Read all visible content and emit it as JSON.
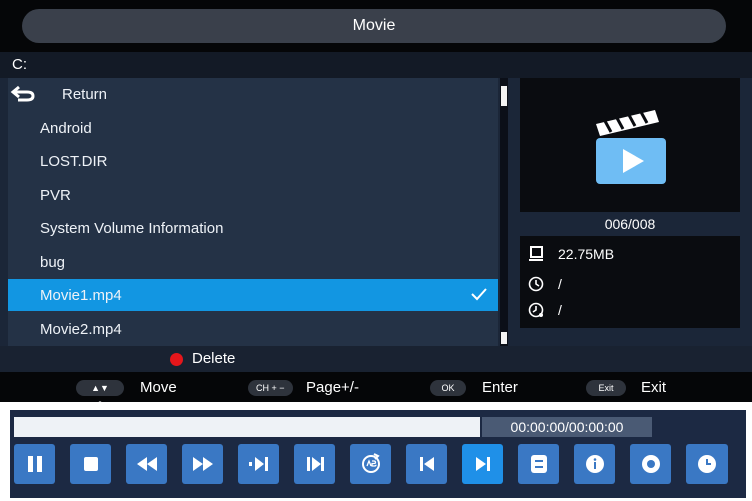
{
  "header": {
    "title": "Movie"
  },
  "path": "C:",
  "file_list": {
    "items": [
      {
        "label": "Return",
        "type": "return"
      },
      {
        "label": "Android"
      },
      {
        "label": "LOST.DIR"
      },
      {
        "label": "PVR"
      },
      {
        "label": "System Volume Information"
      },
      {
        "label": "bug"
      },
      {
        "label": "Movie1.mp4",
        "selected": true
      },
      {
        "label": "Movie2.mp4"
      }
    ]
  },
  "preview": {
    "icon": "clapperboard-play-icon",
    "count": "006/008",
    "size": "22.75MB",
    "duration": "/",
    "date": "/"
  },
  "delete": {
    "label": "Delete",
    "color": "#e5161b"
  },
  "help": {
    "move_keys": "▲▼ ◀▶",
    "move_label": "Move",
    "page_keys": "CH + −",
    "page_label": "Page+/-",
    "ok_key": "OK",
    "ok_label": "Enter",
    "exit_key": "Exit",
    "exit_label": "Exit"
  },
  "player": {
    "time": "00:00:00/00:00:00",
    "progress": 0,
    "controls": [
      "pause",
      "stop",
      "rewind",
      "fast-forward",
      "slow",
      "step",
      "repeat-ab",
      "previous",
      "next",
      "playlist",
      "info",
      "settings",
      "clock"
    ],
    "active_control": "next"
  }
}
